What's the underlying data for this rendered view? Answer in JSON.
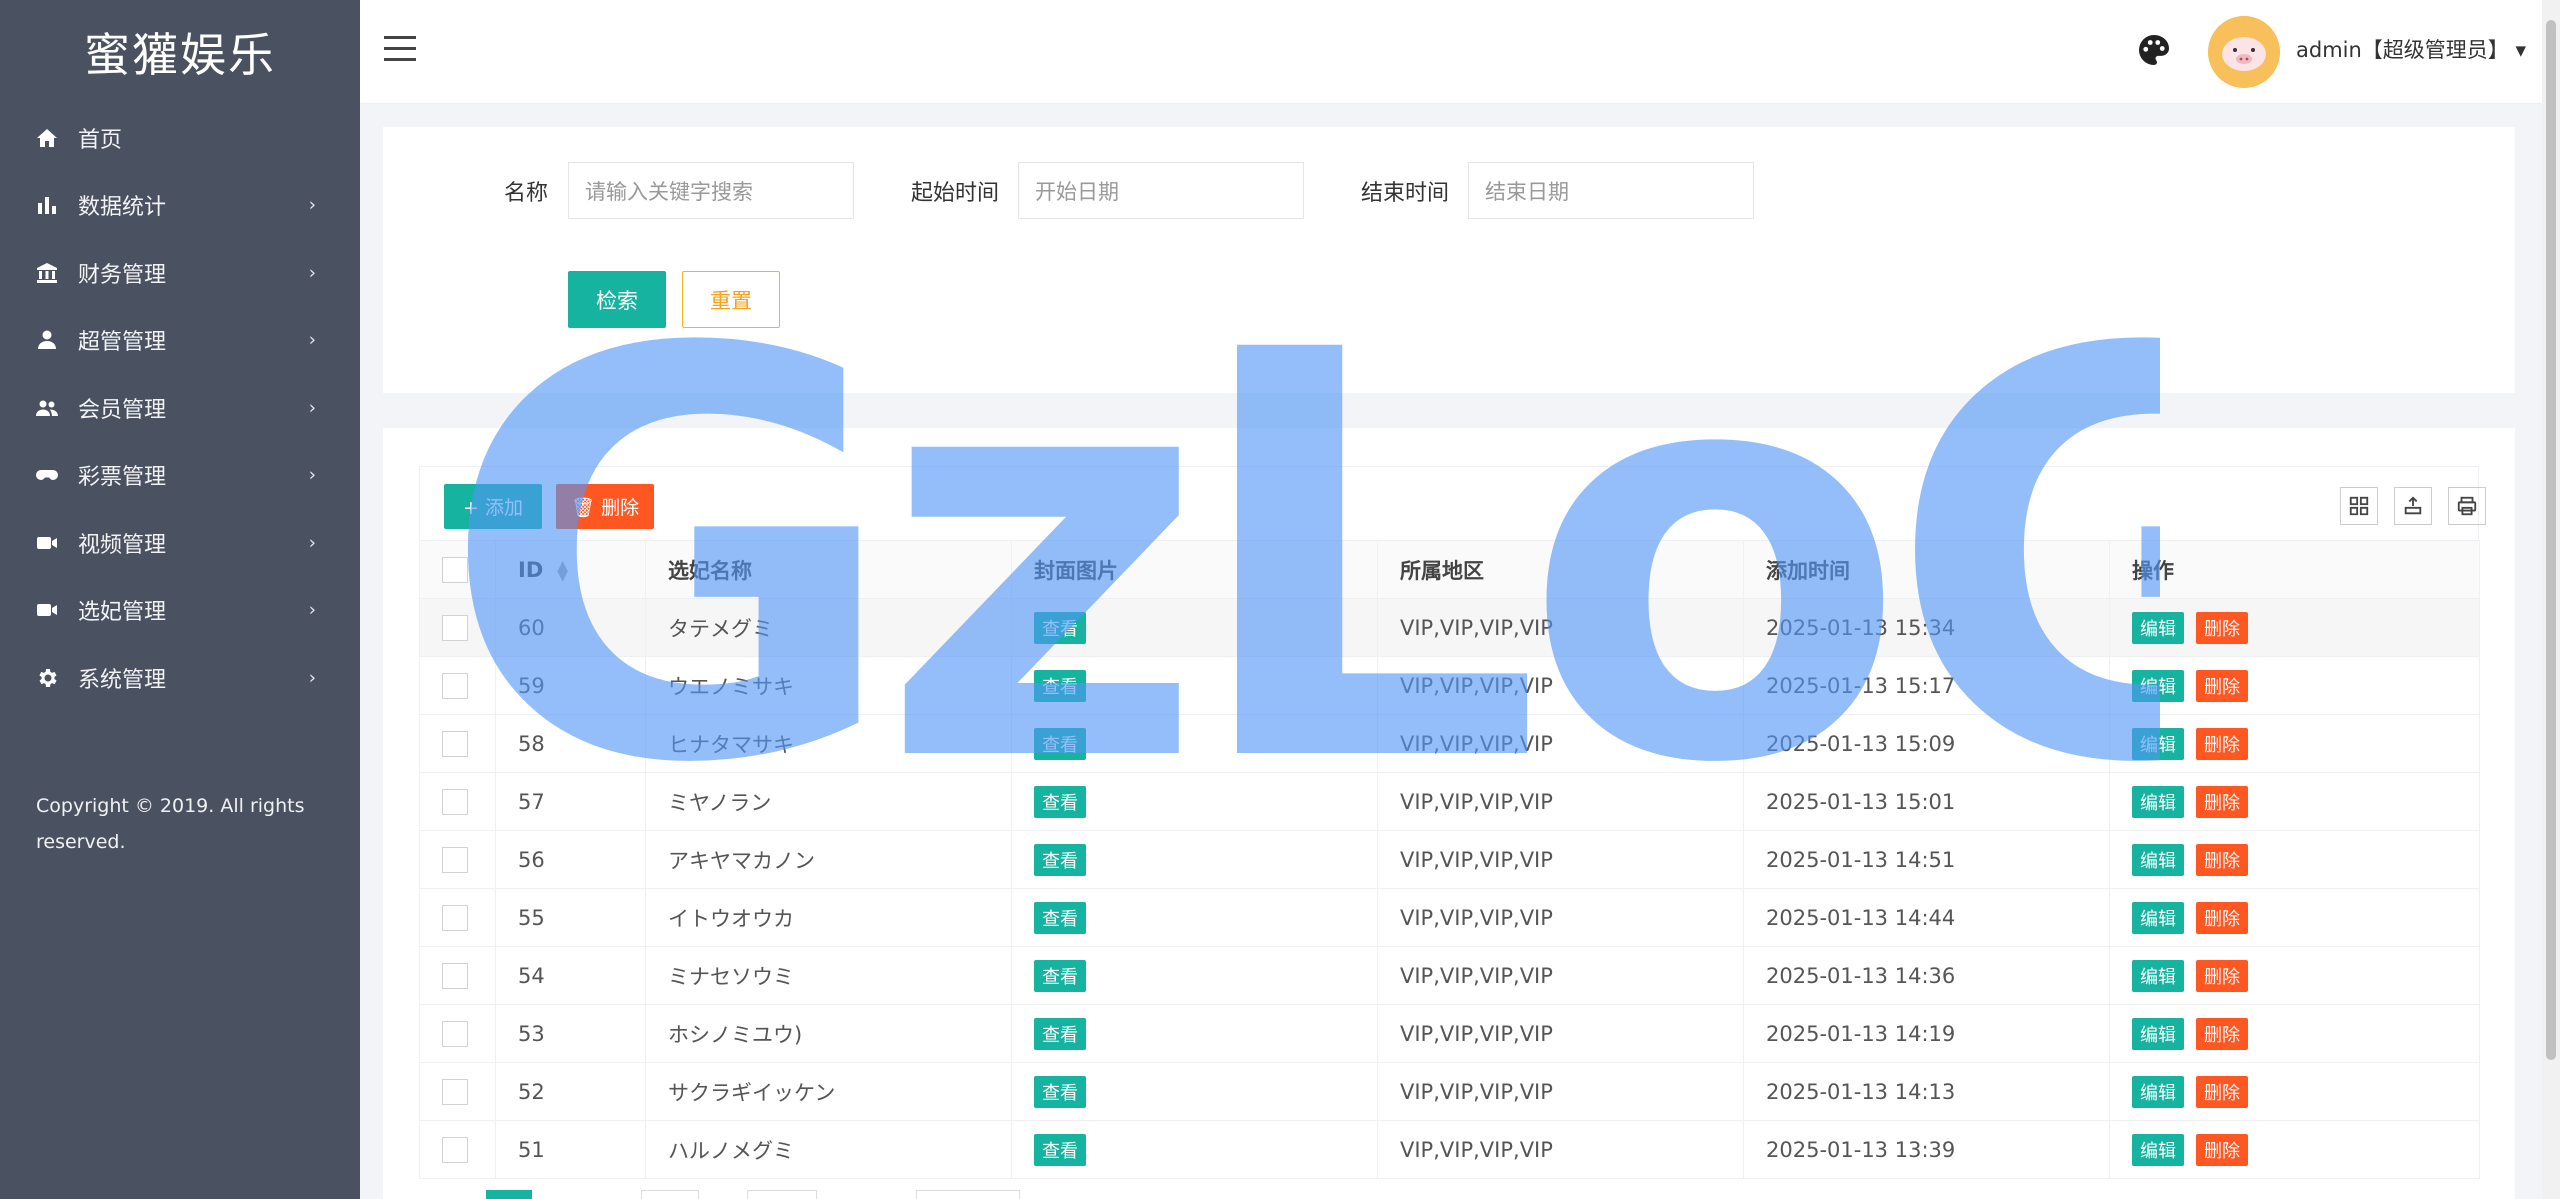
{
  "brand": {
    "name": "蜜獾娱乐"
  },
  "sidebar": {
    "items": [
      {
        "label": "首页",
        "icon": "home-icon",
        "has_children": false
      },
      {
        "label": "数据统计",
        "icon": "bar-chart-icon",
        "has_children": true
      },
      {
        "label": "财务管理",
        "icon": "bank-icon",
        "has_children": true
      },
      {
        "label": "超管管理",
        "icon": "user-icon",
        "has_children": true
      },
      {
        "label": "会员管理",
        "icon": "users-icon",
        "has_children": true
      },
      {
        "label": "彩票管理",
        "icon": "gamepad-icon",
        "has_children": true
      },
      {
        "label": "视频管理",
        "icon": "video-camera-icon",
        "has_children": true
      },
      {
        "label": "选妃管理",
        "icon": "video-camera-icon",
        "has_children": true
      },
      {
        "label": "系统管理",
        "icon": "gear-icon",
        "has_children": true
      }
    ],
    "chevron": "›",
    "copyright": "Copyright © 2019. All rights reserved."
  },
  "header": {
    "user": "admin【超级管理员】",
    "caret": "▾"
  },
  "search": {
    "name_label": "名称",
    "name_placeholder": "请输入关键字搜索",
    "start_label": "起始时间",
    "start_placeholder": "开始日期",
    "end_label": "结束时间",
    "end_placeholder": "结束日期",
    "search_button": "检索",
    "reset_button": "重置"
  },
  "toolbar": {
    "add_label": "+ 添加",
    "delete_label": "🗑 删除"
  },
  "table": {
    "columns": [
      "ID",
      "选妃名称",
      "封面图片",
      "所属地区",
      "添加时间",
      "操作"
    ],
    "view_label": "查看",
    "edit_label": "编辑",
    "delete_label": "删除",
    "rows": [
      {
        "id": "60",
        "name": "タテメグミ",
        "region": "VIP,VIP,VIP,VIP",
        "time": "2025-01-13 15:34"
      },
      {
        "id": "59",
        "name": "ウエノミサキ",
        "region": "VIP,VIP,VIP,VIP",
        "time": "2025-01-13 15:17"
      },
      {
        "id": "58",
        "name": "ヒナタマサキ",
        "region": "VIP,VIP,VIP,VIP",
        "time": "2025-01-13 15:09"
      },
      {
        "id": "57",
        "name": "ミヤノラン",
        "region": "VIP,VIP,VIP,VIP",
        "time": "2025-01-13 15:01"
      },
      {
        "id": "56",
        "name": "アキヤマカノン",
        "region": "VIP,VIP,VIP,VIP",
        "time": "2025-01-13 14:51"
      },
      {
        "id": "55",
        "name": "イトウオウカ",
        "region": "VIP,VIP,VIP,VIP",
        "time": "2025-01-13 14:44"
      },
      {
        "id": "54",
        "name": "ミナセソウミ",
        "region": "VIP,VIP,VIP,VIP",
        "time": "2025-01-13 14:36"
      },
      {
        "id": "53",
        "name": "ホシノミユウ)",
        "region": "VIP,VIP,VIP,VIP",
        "time": "2025-01-13 14:19"
      },
      {
        "id": "52",
        "name": "サクラギイッケン",
        "region": "VIP,VIP,VIP,VIP",
        "time": "2025-01-13 14:13"
      },
      {
        "id": "51",
        "name": "ハルノメグミ",
        "region": "VIP,VIP,VIP,VIP",
        "time": "2025-01-13 13:39"
      }
    ]
  },
  "watermark": "GzLoG",
  "colors": {
    "sidebar": "#4a5160",
    "primary": "#16b3a0",
    "danger": "#ff5722",
    "warning": "#f5b61d"
  }
}
